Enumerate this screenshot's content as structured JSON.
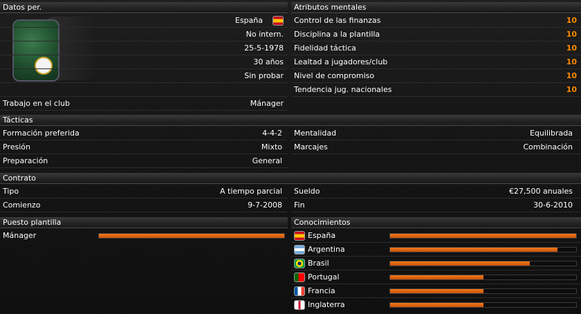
{
  "personal": {
    "header": "Datos per.",
    "nationality": "España",
    "intl": "No intern.",
    "dob": "25-5-1978",
    "age": "30 años",
    "status": "Sin probar",
    "job_label": "Trabajo en el club",
    "job_value": "Mánager"
  },
  "mental": {
    "header": "Atributos mentales",
    "items": [
      {
        "label": "Control de las finanzas",
        "value": "10"
      },
      {
        "label": "Disciplina a la plantilla",
        "value": "10"
      },
      {
        "label": "Fidelidad táctica",
        "value": "10"
      },
      {
        "label": "Lealtad a jugadores/club",
        "value": "10"
      },
      {
        "label": "Nivel de compromiso",
        "value": "10"
      },
      {
        "label": "Tendencia jug. nacionales",
        "value": "10"
      }
    ]
  },
  "tactics": {
    "header": "Tácticas",
    "formation_label": "Formación preferida",
    "formation_value": "4-4-2",
    "pressure_label": "Presión",
    "pressure_value": "Mixto",
    "prep_label": "Preparación",
    "prep_value": "General",
    "mentality_label": "Mentalidad",
    "mentality_value": "Equilibrada",
    "marking_label": "Marcajes",
    "marking_value": "Combinación"
  },
  "contract": {
    "header": "Contrato",
    "type_label": "Tipo",
    "type_value": "A tiempo parcial",
    "start_label": "Comienzo",
    "start_value": "9-7-2008",
    "salary_label": "Sueldo",
    "salary_value": "€27,500 anuales",
    "end_label": "Fin",
    "end_value": "30-6-2010"
  },
  "position": {
    "header": "Puesto plantilla",
    "label": "Mánager",
    "level": 1.0
  },
  "knowledge": {
    "header": "Conocimientos",
    "items": [
      {
        "country": "España",
        "level": 1.0,
        "flag": "spain-flag-icon"
      },
      {
        "country": "Argentina",
        "level": 0.9,
        "flag": "argentina-flag-icon"
      },
      {
        "country": "Brasil",
        "level": 0.75,
        "flag": "brazil-flag-icon"
      },
      {
        "country": "Portugal",
        "level": 0.5,
        "flag": "portugal-flag-icon"
      },
      {
        "country": "Francia",
        "level": 0.5,
        "flag": "france-flag-icon"
      },
      {
        "country": "Inglaterra",
        "level": 0.5,
        "flag": "england-flag-icon"
      }
    ]
  },
  "colors": {
    "accent": "#ff8a00",
    "bar": "#e06a14"
  }
}
